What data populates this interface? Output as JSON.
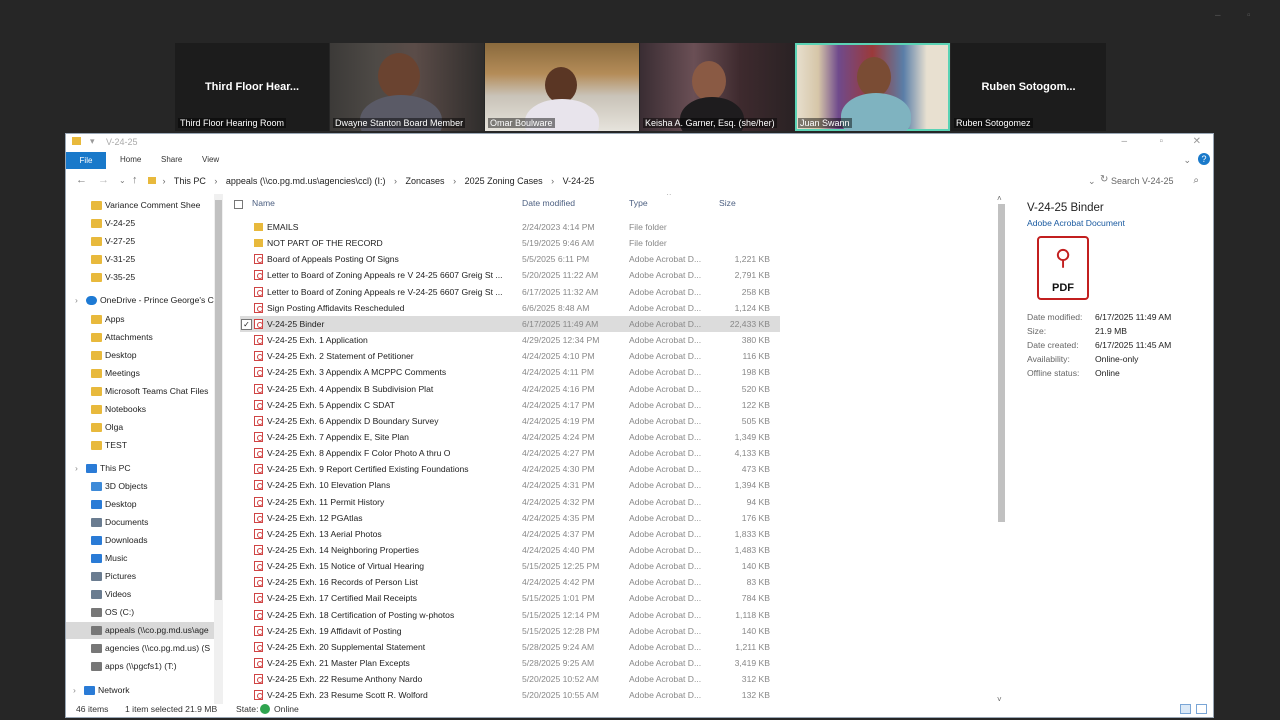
{
  "participants": [
    {
      "name": "Third Floor Hear...",
      "caption": "Third Floor Hearing Room",
      "video": false
    },
    {
      "name": "",
      "caption": "Dwayne Stanton  Board Member",
      "video": true
    },
    {
      "name": "",
      "caption": "Omar Boulware",
      "video": true
    },
    {
      "name": "",
      "caption": "Keisha A. Garner, Esq. (she/her)",
      "video": true
    },
    {
      "name": "",
      "caption": "Juan Swann",
      "video": true,
      "active": true
    },
    {
      "name": "Ruben  Sotogom...",
      "caption": "Ruben Sotogomez",
      "video": false
    }
  ],
  "explorer": {
    "title": "V-24-25",
    "ribbon_tabs": [
      "File",
      "Home",
      "Share",
      "View"
    ],
    "help": "?",
    "breadcrumbs": [
      "This PC",
      "appeals (\\\\co.pg.md.us\\agencies\\ccl) (I:)",
      "Zoncases",
      "2025 Zoning Cases",
      "V-24-25"
    ],
    "search_placeholder": "Search V-24-25",
    "nav_items": [
      {
        "label": "Variance Comment Shee",
        "type": "folder"
      },
      {
        "label": "V-24-25",
        "type": "folder"
      },
      {
        "label": "V-27-25",
        "type": "folder"
      },
      {
        "label": "V-31-25",
        "type": "folder"
      },
      {
        "label": "V-35-25",
        "type": "folder"
      },
      {
        "label": "OneDrive - Prince George's C",
        "type": "cloud"
      },
      {
        "label": "Apps",
        "type": "folder"
      },
      {
        "label": "Attachments",
        "type": "folder"
      },
      {
        "label": "Desktop",
        "type": "folder"
      },
      {
        "label": "Meetings",
        "type": "folder"
      },
      {
        "label": "Microsoft Teams Chat Files",
        "type": "folder"
      },
      {
        "label": "Notebooks",
        "type": "folder"
      },
      {
        "label": "Olga",
        "type": "folder"
      },
      {
        "label": "TEST",
        "type": "folder"
      },
      {
        "label": "This PC",
        "type": "pc"
      },
      {
        "label": "3D Objects",
        "type": "obj3d"
      },
      {
        "label": "Desktop",
        "type": "desk"
      },
      {
        "label": "Documents",
        "type": "docs"
      },
      {
        "label": "Downloads",
        "type": "down"
      },
      {
        "label": "Music",
        "type": "music"
      },
      {
        "label": "Pictures",
        "type": "pics"
      },
      {
        "label": "Videos",
        "type": "videos"
      },
      {
        "label": "OS (C:)",
        "type": "drive"
      },
      {
        "label": "appeals (\\\\co.pg.md.us\\age",
        "type": "net",
        "selected": true
      },
      {
        "label": "agencies (\\\\co.pg.md.us) (S",
        "type": "net"
      },
      {
        "label": "apps (\\\\pgcfs1) (T:)",
        "type": "net"
      },
      {
        "label": "Network",
        "type": "network"
      }
    ],
    "columns": {
      "name": "Name",
      "date": "Date modified",
      "type": "Type",
      "size": "Size"
    },
    "files": [
      {
        "name": "EMAILS",
        "date": "2/24/2023 4:14 PM",
        "type": "File folder",
        "size": "",
        "kind": "folder"
      },
      {
        "name": "NOT PART OF THE RECORD",
        "date": "5/19/2025 9:46 AM",
        "type": "File folder",
        "size": "",
        "kind": "folder"
      },
      {
        "name": "Board of Appeals Posting Of Signs",
        "date": "5/5/2025 6:11 PM",
        "type": "Adobe Acrobat D...",
        "size": "1,221 KB",
        "kind": "pdf"
      },
      {
        "name": "Letter to Board of Zoning Appeals re V 24-25 6607 Greig St ...",
        "date": "5/20/2025 11:22 AM",
        "type": "Adobe Acrobat D...",
        "size": "2,791 KB",
        "kind": "pdf"
      },
      {
        "name": "Letter to Board of Zoning Appeals re V-24-25 6607 Greig St ...",
        "date": "6/17/2025 11:32 AM",
        "type": "Adobe Acrobat D...",
        "size": "258 KB",
        "kind": "pdf"
      },
      {
        "name": "Sign Posting Affidavits Rescheduled",
        "date": "6/6/2025 8:48 AM",
        "type": "Adobe Acrobat D...",
        "size": "1,124 KB",
        "kind": "pdf"
      },
      {
        "name": "V-24-25 Binder",
        "date": "6/17/2025 11:49 AM",
        "type": "Adobe Acrobat D...",
        "size": "22,433 KB",
        "kind": "pdf",
        "selected": true
      },
      {
        "name": "V-24-25 Exh. 1 Application",
        "date": "4/29/2025 12:34 PM",
        "type": "Adobe Acrobat D...",
        "size": "380 KB",
        "kind": "pdf"
      },
      {
        "name": "V-24-25 Exh. 2 Statement of Petitioner",
        "date": "4/24/2025 4:10 PM",
        "type": "Adobe Acrobat D...",
        "size": "116 KB",
        "kind": "pdf"
      },
      {
        "name": "V-24-25 Exh. 3 Appendix A MCPPC Comments",
        "date": "4/24/2025 4:11 PM",
        "type": "Adobe Acrobat D...",
        "size": "198 KB",
        "kind": "pdf"
      },
      {
        "name": "V-24-25 Exh. 4 Appendix B Subdivision Plat",
        "date": "4/24/2025 4:16 PM",
        "type": "Adobe Acrobat D...",
        "size": "520 KB",
        "kind": "pdf"
      },
      {
        "name": "V-24-25 Exh. 5 Appendix C SDAT",
        "date": "4/24/2025 4:17 PM",
        "type": "Adobe Acrobat D...",
        "size": "122 KB",
        "kind": "pdf"
      },
      {
        "name": "V-24-25 Exh. 6 Appendix D Boundary Survey",
        "date": "4/24/2025 4:19 PM",
        "type": "Adobe Acrobat D...",
        "size": "505 KB",
        "kind": "pdf"
      },
      {
        "name": "V-24-25 Exh. 7 Appendix E, Site Plan",
        "date": "4/24/2025 4:24 PM",
        "type": "Adobe Acrobat D...",
        "size": "1,349 KB",
        "kind": "pdf"
      },
      {
        "name": "V-24-25 Exh. 8 Appendix F Color Photo A thru O",
        "date": "4/24/2025 4:27 PM",
        "type": "Adobe Acrobat D...",
        "size": "4,133 KB",
        "kind": "pdf"
      },
      {
        "name": "V-24-25 Exh. 9 Report Certified Existing Foundations",
        "date": "4/24/2025 4:30 PM",
        "type": "Adobe Acrobat D...",
        "size": "473 KB",
        "kind": "pdf"
      },
      {
        "name": "V-24-25 Exh. 10 Elevation Plans",
        "date": "4/24/2025 4:31 PM",
        "type": "Adobe Acrobat D...",
        "size": "1,394 KB",
        "kind": "pdf"
      },
      {
        "name": "V-24-25 Exh. 11 Permit History",
        "date": "4/24/2025 4:32 PM",
        "type": "Adobe Acrobat D...",
        "size": "94 KB",
        "kind": "pdf"
      },
      {
        "name": "V-24-25 Exh. 12 PGAtlas",
        "date": "4/24/2025 4:35 PM",
        "type": "Adobe Acrobat D...",
        "size": "176 KB",
        "kind": "pdf"
      },
      {
        "name": "V-24-25 Exh. 13  Aerial Photos",
        "date": "4/24/2025 4:37 PM",
        "type": "Adobe Acrobat D...",
        "size": "1,833 KB",
        "kind": "pdf"
      },
      {
        "name": "V-24-25 Exh. 14 Neighboring Properties",
        "date": "4/24/2025 4:40 PM",
        "type": "Adobe Acrobat D...",
        "size": "1,483 KB",
        "kind": "pdf"
      },
      {
        "name": "V-24-25 Exh. 15 Notice of Virtual Hearing",
        "date": "5/15/2025 12:25 PM",
        "type": "Adobe Acrobat D...",
        "size": "140 KB",
        "kind": "pdf"
      },
      {
        "name": "V-24-25 Exh. 16 Records of Person List",
        "date": "4/24/2025 4:42 PM",
        "type": "Adobe Acrobat D...",
        "size": "83 KB",
        "kind": "pdf"
      },
      {
        "name": "V-24-25 Exh. 17 Certified Mail Receipts",
        "date": "5/15/2025 1:01 PM",
        "type": "Adobe Acrobat D...",
        "size": "784 KB",
        "kind": "pdf"
      },
      {
        "name": "V-24-25 Exh.  18 Certification of Posting w-photos",
        "date": "5/15/2025 12:14 PM",
        "type": "Adobe Acrobat D...",
        "size": "1,118 KB",
        "kind": "pdf"
      },
      {
        "name": "V-24-25 Exh. 19 Affidavit of Posting",
        "date": "5/15/2025 12:28 PM",
        "type": "Adobe Acrobat D...",
        "size": "140 KB",
        "kind": "pdf"
      },
      {
        "name": "V-24-25 Exh. 20 Supplemental Statement",
        "date": "5/28/2025 9:24 AM",
        "type": "Adobe Acrobat D...",
        "size": "1,211 KB",
        "kind": "pdf"
      },
      {
        "name": "V-24-25 Exh. 21 Master Plan Excepts",
        "date": "5/28/2025 9:25 AM",
        "type": "Adobe Acrobat D...",
        "size": "3,419 KB",
        "kind": "pdf"
      },
      {
        "name": "V-24-25 Exh. 22 Resume Anthony Nardo",
        "date": "5/20/2025 10:52 AM",
        "type": "Adobe Acrobat D...",
        "size": "312 KB",
        "kind": "pdf"
      },
      {
        "name": "V-24-25 Exh. 23 Resume Scott R. Wolford",
        "date": "5/20/2025 10:55 AM",
        "type": "Adobe Acrobat D...",
        "size": "132 KB",
        "kind": "pdf"
      }
    ],
    "preview": {
      "title": "V-24-25 Binder",
      "subtitle": "Adobe Acrobat Document",
      "icon_label": "PDF",
      "icon": "pdf-icon",
      "meta": [
        {
          "k": "Date modified:",
          "v": "6/17/2025 11:49 AM"
        },
        {
          "k": "Size:",
          "v": "21.9 MB"
        },
        {
          "k": "Date created:",
          "v": "6/17/2025 11:45 AM"
        },
        {
          "k": "Availability:",
          "v": "Online-only"
        },
        {
          "k": "Offline status:",
          "v": "Online"
        }
      ]
    },
    "status": {
      "items": "46 items",
      "selected": "1 item selected  21.9 MB",
      "state_label": "State:",
      "state_value": "Online"
    }
  }
}
